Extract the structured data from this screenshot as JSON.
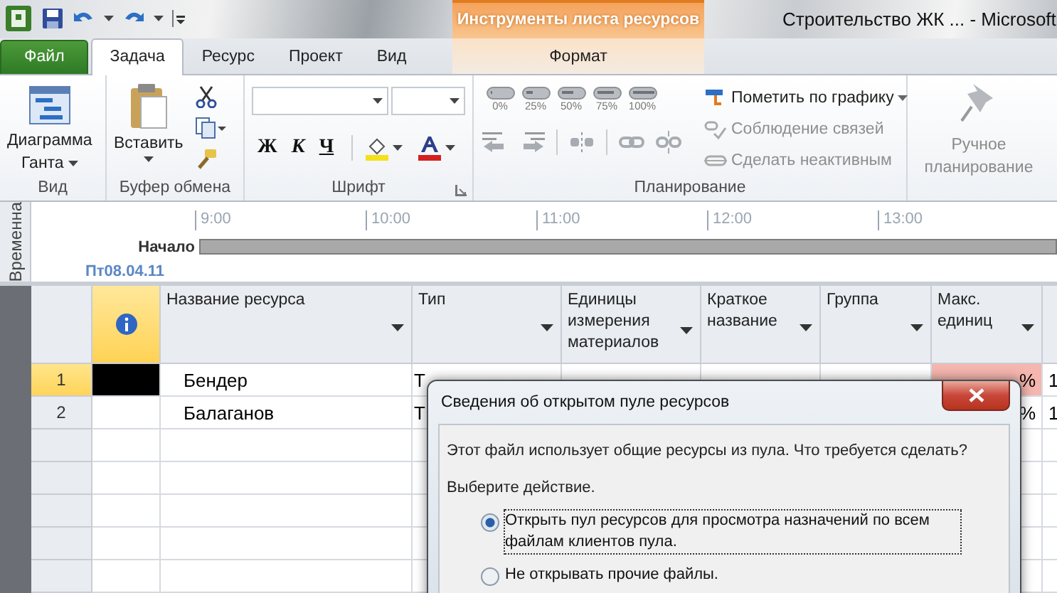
{
  "contextual_group": {
    "title": "Инструменты листа ресурсов"
  },
  "window_title": "Строительство ЖК ...  -  Microsoft",
  "tabs": [
    {
      "label": "Файл",
      "kind": "file",
      "selected": false
    },
    {
      "label": "Задача",
      "kind": "normal",
      "selected": true
    },
    {
      "label": "Ресурс",
      "kind": "normal",
      "selected": false
    },
    {
      "label": "Проект",
      "kind": "normal",
      "selected": false
    },
    {
      "label": "Вид",
      "kind": "normal",
      "selected": false
    },
    {
      "label": "Формат",
      "kind": "contextual",
      "selected": false
    }
  ],
  "ribbon": {
    "view": {
      "label": "Вид",
      "gantt_button": [
        "Диаграмма",
        "Ганта"
      ]
    },
    "clipboard": {
      "label": "Буфер обмена",
      "paste_button": "Вставить"
    },
    "font": {
      "label": "Шрифт",
      "bold": "Ж",
      "italic": "К",
      "underline": "Ч"
    },
    "planning": {
      "label": "Планирование",
      "percent_buttons": [
        "0%",
        "25%",
        "50%",
        "75%",
        "100%"
      ],
      "commands": [
        {
          "label": "Пометить по графику",
          "disabled": false,
          "has_menu": true
        },
        {
          "label": "Соблюдение связей",
          "disabled": true,
          "has_menu": false
        },
        {
          "label": "Сделать неактивным",
          "disabled": true,
          "has_menu": false
        }
      ]
    },
    "manual_button": [
      "Ручное",
      "планирование"
    ]
  },
  "timeline": {
    "label": "Временна",
    "start_label": "Начало",
    "start_date": "Пт08.04.11",
    "ticks": [
      "9:00",
      "10:00",
      "11:00",
      "12:00",
      "13:00"
    ]
  },
  "table": {
    "columns": [
      {
        "kind": "info"
      },
      {
        "kind": "text",
        "label": "Название ресурса"
      },
      {
        "kind": "text",
        "label": "Тип"
      },
      {
        "kind": "text",
        "label": "Единицы измерения материалов"
      },
      {
        "kind": "text",
        "label": "Краткое название"
      },
      {
        "kind": "text",
        "label": "Группа"
      },
      {
        "kind": "text",
        "label": "Макс. единиц"
      },
      {
        "kind": "cut"
      }
    ],
    "rows": [
      {
        "number": "1",
        "selected": true,
        "name": "Бендер",
        "type": "Т",
        "max_units": "%",
        "overallocated": true,
        "column_8": "1"
      },
      {
        "number": "2",
        "selected": false,
        "name": "Балаганов",
        "type": "Т",
        "max_units": "%",
        "column_8": "1"
      }
    ]
  },
  "dialog": {
    "title": "Сведения об открытом пуле ресурсов",
    "message": "Этот файл использует общие ресурсы из пула.  Что требуется сделать?",
    "prompt": "Выберите действие.",
    "options": [
      {
        "label": "Открыть пул ресурсов для просмотра назначений по всем файлам клиентов пула.",
        "selected": true
      },
      {
        "label": "Не открывать прочие файлы.",
        "selected": false
      }
    ]
  }
}
